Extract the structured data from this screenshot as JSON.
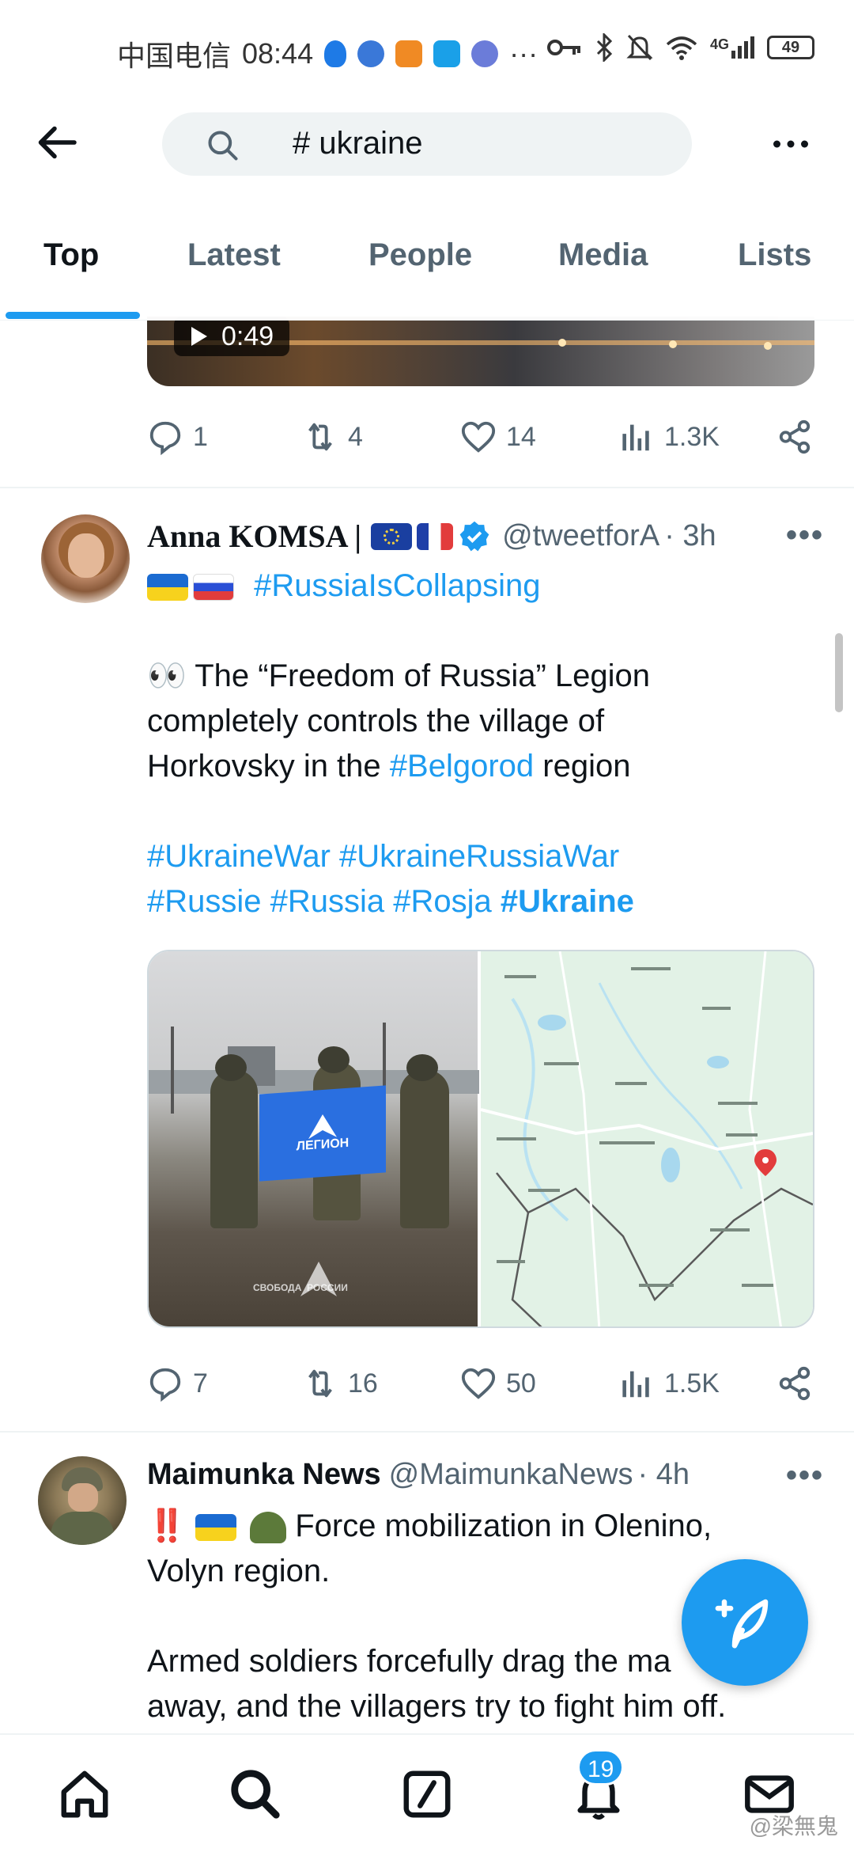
{
  "status_bar": {
    "carrier": "中国电信",
    "time": "08:44",
    "battery": "49",
    "signal_label": "4G",
    "overflow": "···"
  },
  "header": {
    "search_text": "# ukraine",
    "tabs": [
      {
        "label": "Top"
      },
      {
        "label": "Latest"
      },
      {
        "label": "People"
      },
      {
        "label": "Media"
      },
      {
        "label": "Lists"
      }
    ]
  },
  "prev_tweet": {
    "video_duration": "0:49",
    "replies": "1",
    "retweets": "4",
    "likes": "14",
    "views": "1.3K"
  },
  "tweet1": {
    "name": "Anna KOMSA |",
    "handle": "@tweetforA",
    "time": "· 3h",
    "header_tag": "#RussiaIsCollapsing",
    "line1_emoji": "👀",
    "line1_text": " The “Freedom of Russia” Legion",
    "line2": "completely controls the village of",
    "line3_pre": "Horkovsky in the ",
    "line3_tag": "#Belgorod",
    "line3_post": " region",
    "tags_line1": [
      "#UkraineWar",
      "#UkraineRussiaWar"
    ],
    "tags_line2": [
      "#Russie",
      "#Russia",
      "#Rosja"
    ],
    "tag_bold": "#Ukraine",
    "photo_caption": "СВОБОДА  РОССИИ",
    "flag_text": "ЛЕГИОН",
    "replies": "7",
    "retweets": "16",
    "likes": "50",
    "views": "1.5K"
  },
  "tweet2": {
    "name": "Maimunka News",
    "handle": "@MaimunkaNews",
    "time": "· 4h",
    "line1_emoji": "‼️",
    "line1_text": " Force mobilization in Olenino,",
    "line2": "Volyn region.",
    "line3": "Armed soldiers forcefully drag the ma",
    "line4": "away, and the villagers try to fight him off."
  },
  "bottom_nav": {
    "notifications_badge": "19",
    "watermark": "@梁無鬼"
  },
  "colors": {
    "accent": "#1d9bf0",
    "text": "#0f1419",
    "muted": "#536471"
  }
}
